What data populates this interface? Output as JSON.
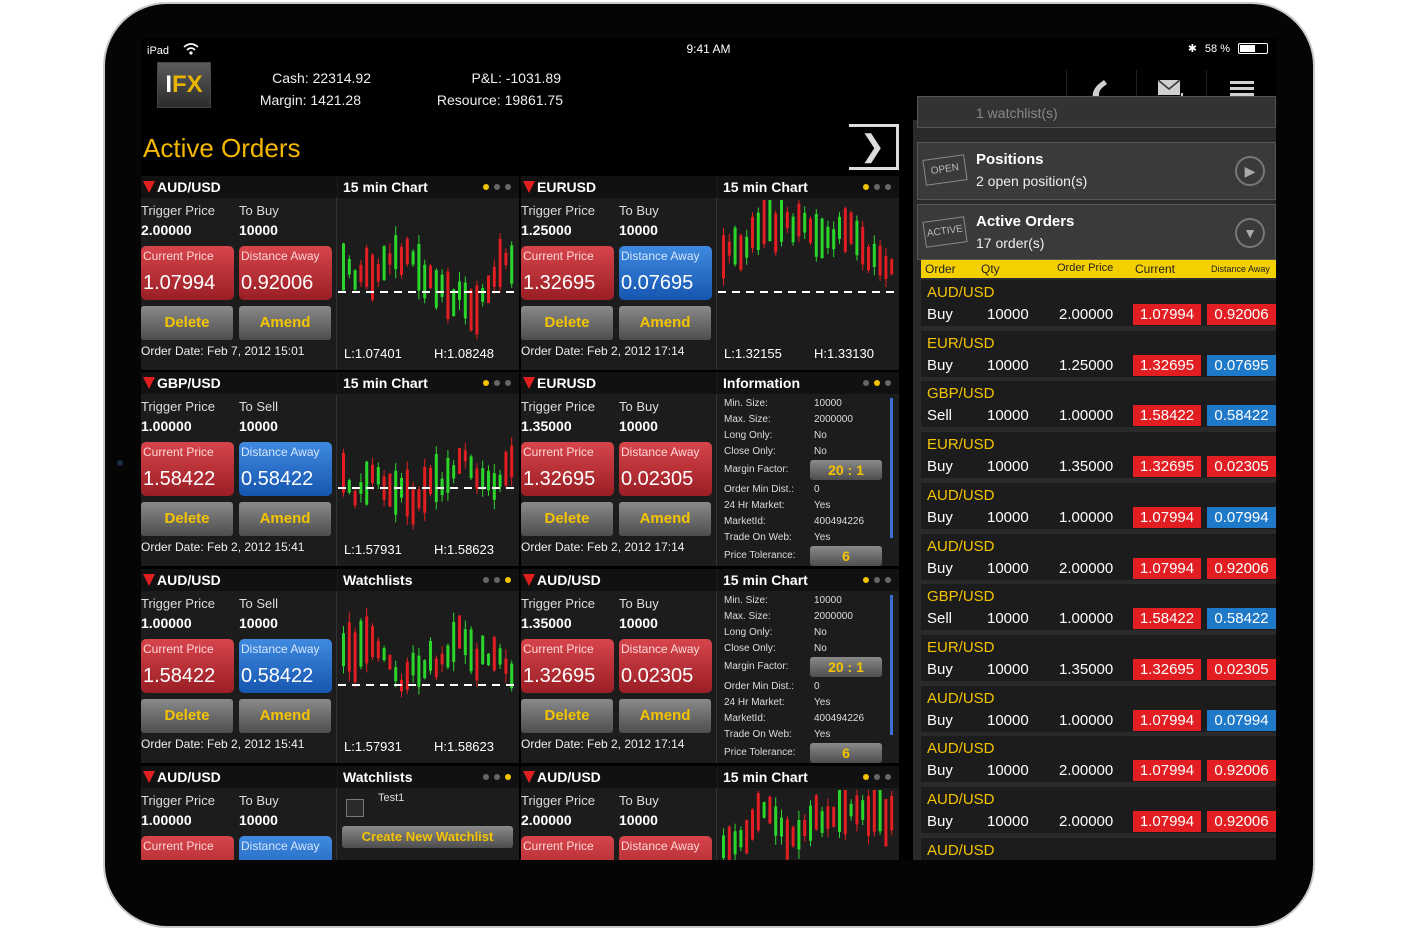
{
  "status": {
    "device": "iPad",
    "time": "9:41 AM",
    "battery": "58 %",
    "battery_fraction": 0.58
  },
  "header": {
    "logo": "IFX",
    "cash": "Cash: 22314.92",
    "margin": "Margin: 1421.28",
    "pnl": "P&L: -1031.89",
    "resource": "Resource: 19861.75",
    "icons": [
      "phone-icon",
      "mail-add-icon",
      "menu-icon"
    ]
  },
  "page_title": "Active Orders",
  "cards": [
    {
      "pair": "AUD/USD",
      "trigger_label": "Trigger Price",
      "trigger": "2.00000",
      "side_label": "To Buy",
      "amount": "10000",
      "current_label": "Current Price",
      "current": "1.07994",
      "distance_label": "Distance Away",
      "distance": "0.92006",
      "distance_color": "red",
      "delete": "Delete",
      "amend": "Amend",
      "order_date": "Order Date: Feb 7, 2012 15:01",
      "panel": "chart",
      "panel_title": "15 min Chart",
      "low": "L:1.07401",
      "high": "H:1.08248",
      "dots": [
        1,
        0,
        0
      ]
    },
    {
      "pair": "EURUSD",
      "trigger_label": "Trigger Price",
      "trigger": "1.25000",
      "side_label": "To Buy",
      "amount": "10000",
      "current_label": "Current Price",
      "current": "1.32695",
      "distance_label": "Distance Away",
      "distance": "0.07695",
      "distance_color": "blue",
      "delete": "Delete",
      "amend": "Amend",
      "order_date": "Order Date: Feb 2, 2012 17:14",
      "panel": "chart",
      "panel_title": "15 min Chart",
      "low": "L:1.32155",
      "high": "H:1.33130",
      "dots": [
        1,
        0,
        0
      ]
    },
    {
      "pair": "GBP/USD",
      "trigger_label": "Trigger Price",
      "trigger": "1.00000",
      "side_label": "To Sell",
      "amount": "10000",
      "current_label": "Current Price",
      "current": "1.58422",
      "distance_label": "Distance Away",
      "distance": "0.58422",
      "distance_color": "blue",
      "delete": "Delete",
      "amend": "Amend",
      "order_date": "Order Date: Feb 2, 2012 15:41",
      "panel": "chart",
      "panel_title": "15 min Chart",
      "low": "L:1.57931",
      "high": "H:1.58623",
      "dots": [
        1,
        0,
        0
      ]
    },
    {
      "pair": "EURUSD",
      "trigger_label": "Trigger Price",
      "trigger": "1.35000",
      "side_label": "To Buy",
      "amount": "10000",
      "current_label": "Current Price",
      "current": "1.32695",
      "distance_label": "Distance Away",
      "distance": "0.02305",
      "distance_color": "red",
      "delete": "Delete",
      "amend": "Amend",
      "order_date": "Order Date: Feb 2, 2012 17:14",
      "panel": "info",
      "panel_title": "Information",
      "dots": [
        0,
        1,
        0
      ]
    },
    {
      "pair": "AUD/USD",
      "trigger_label": "Trigger Price",
      "trigger": "1.00000",
      "side_label": "To Sell",
      "amount": "10000",
      "current_label": "Current Price",
      "current": "1.58422",
      "distance_label": "Distance Away",
      "distance": "0.58422",
      "distance_color": "blue",
      "delete": "Delete",
      "amend": "Amend",
      "order_date": "Order Date: Feb 2, 2012 15:41",
      "panel": "chart",
      "panel_title": "Watchlists",
      "low": "L:1.57931",
      "high": "H:1.58623",
      "dots": [
        0,
        0,
        1
      ]
    },
    {
      "pair": "AUD/USD",
      "trigger_label": "Trigger Price",
      "trigger": "1.35000",
      "side_label": "To Buy",
      "amount": "10000",
      "current_label": "Current Price",
      "current": "1.32695",
      "distance_label": "Distance Away",
      "distance": "0.02305",
      "distance_color": "red",
      "delete": "Delete",
      "amend": "Amend",
      "order_date": "Order Date: Feb 2, 2012 17:14",
      "panel": "info",
      "panel_title": "15 min Chart",
      "dots": [
        1,
        0,
        0
      ]
    },
    {
      "pair": "AUD/USD",
      "trigger_label": "Trigger Price",
      "trigger": "1.00000",
      "side_label": "To Buy",
      "amount": "10000",
      "current_label": "Current Price",
      "current": "",
      "distance_label": "Distance Away",
      "distance": "",
      "distance_color": "blue",
      "delete": "",
      "amend": "",
      "order_date": "",
      "panel": "watchlist",
      "panel_title": "Watchlists",
      "watchlist_item": "Test1",
      "create_watchlist": "Create New Watchlist",
      "dots": [
        0,
        0,
        1
      ]
    },
    {
      "pair": "AUD/USD",
      "trigger_label": "Trigger Price",
      "trigger": "2.00000",
      "side_label": "To Buy",
      "amount": "10000",
      "current_label": "Current Price",
      "current": "",
      "distance_label": "Distance Away",
      "distance": "",
      "distance_color": "red",
      "delete": "",
      "amend": "",
      "order_date": "",
      "panel": "chart",
      "panel_title": "15 min Chart",
      "low": "",
      "high": "",
      "dots": [
        1,
        0,
        0
      ]
    }
  ],
  "info": {
    "rows": [
      {
        "k": "Min. Size:",
        "v": "10000"
      },
      {
        "k": "Max. Size:",
        "v": "2000000"
      },
      {
        "k": "Long Only:",
        "v": "No"
      },
      {
        "k": "Close Only:",
        "v": "No"
      },
      {
        "k": "Margin Factor:",
        "v": "20 : 1"
      },
      {
        "k": "Order Min Dist.:",
        "v": "0"
      },
      {
        "k": "24 Hr Market:",
        "v": "Yes"
      },
      {
        "k": "MarketId:",
        "v": "400494226"
      },
      {
        "k": "Trade On Web:",
        "v": "Yes"
      },
      {
        "k": "Price Tolerance:",
        "v": "6"
      }
    ]
  },
  "right_panel": {
    "watchlists_partial": "1 watchlist(s)",
    "positions": {
      "icon_text": "OPEN",
      "title": "Positions",
      "subtitle": "2 open position(s)"
    },
    "active": {
      "icon_text": "ACTIVE",
      "title": "Active Orders",
      "subtitle": "17 order(s)"
    },
    "columns": [
      "Order",
      "Qty",
      "Order Price",
      "Current",
      "Distance Away"
    ],
    "orders": [
      {
        "pair": "AUD/USD",
        "side": "Buy",
        "qty": "10000",
        "price": "2.00000",
        "current": "1.07994",
        "distance": "0.92006",
        "dcolor": "red"
      },
      {
        "pair": "EUR/USD",
        "side": "Buy",
        "qty": "10000",
        "price": "1.25000",
        "current": "1.32695",
        "distance": "0.07695",
        "dcolor": "blue"
      },
      {
        "pair": "GBP/USD",
        "side": "Sell",
        "qty": "10000",
        "price": "1.00000",
        "current": "1.58422",
        "distance": "0.58422",
        "dcolor": "blue"
      },
      {
        "pair": "EUR/USD",
        "side": "Buy",
        "qty": "10000",
        "price": "1.35000",
        "current": "1.32695",
        "distance": "0.02305",
        "dcolor": "red"
      },
      {
        "pair": "AUD/USD",
        "side": "Buy",
        "qty": "10000",
        "price": "1.00000",
        "current": "1.07994",
        "distance": "0.07994",
        "dcolor": "blue"
      },
      {
        "pair": "AUD/USD",
        "side": "Buy",
        "qty": "10000",
        "price": "2.00000",
        "current": "1.07994",
        "distance": "0.92006",
        "dcolor": "red"
      },
      {
        "pair": "GBP/USD",
        "side": "Sell",
        "qty": "10000",
        "price": "1.00000",
        "current": "1.58422",
        "distance": "0.58422",
        "dcolor": "blue"
      },
      {
        "pair": "EUR/USD",
        "side": "Buy",
        "qty": "10000",
        "price": "1.35000",
        "current": "1.32695",
        "distance": "0.02305",
        "dcolor": "red"
      },
      {
        "pair": "AUD/USD",
        "side": "Buy",
        "qty": "10000",
        "price": "1.00000",
        "current": "1.07994",
        "distance": "0.07994",
        "dcolor": "blue"
      },
      {
        "pair": "AUD/USD",
        "side": "Buy",
        "qty": "10000",
        "price": "2.00000",
        "current": "1.07994",
        "distance": "0.92006",
        "dcolor": "red"
      },
      {
        "pair": "AUD/USD",
        "side": "Buy",
        "qty": "10000",
        "price": "2.00000",
        "current": "1.07994",
        "distance": "0.92006",
        "dcolor": "red"
      },
      {
        "pair": "AUD/USD",
        "side": "",
        "qty": "",
        "price": "",
        "current": "",
        "distance": "",
        "dcolor": "red"
      }
    ]
  }
}
